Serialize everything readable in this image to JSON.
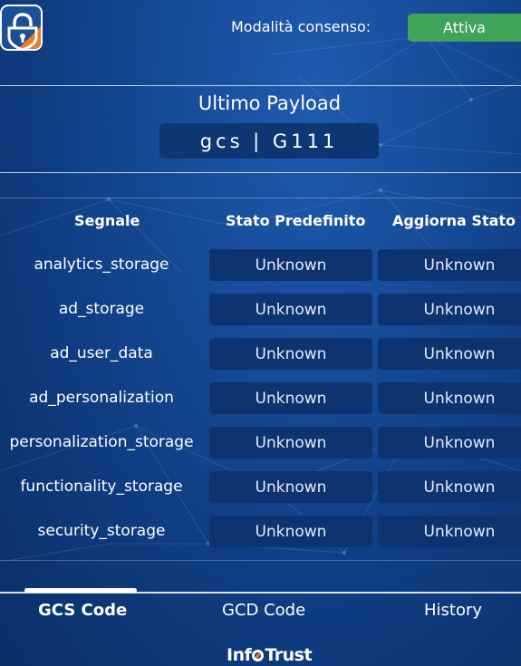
{
  "header": {
    "logo_icon": "lock-shield-icon",
    "consent_label": "Modalità consenso:",
    "consent_status": "Attiva",
    "status_color": "#3fa35a"
  },
  "payload": {
    "title": "Ultimo Payload",
    "value": "gcs | G111"
  },
  "table": {
    "headers": [
      "Segnale",
      "Stato Predefinito",
      "Aggiorna Stato"
    ],
    "rows": [
      {
        "signal": "analytics_storage",
        "default": "Unknown",
        "update": "Unknown"
      },
      {
        "signal": "ad_storage",
        "default": "Unknown",
        "update": "Unknown"
      },
      {
        "signal": "ad_user_data",
        "default": "Unknown",
        "update": "Unknown"
      },
      {
        "signal": "ad_personalization",
        "default": "Unknown",
        "update": "Unknown"
      },
      {
        "signal": "personalization_storage",
        "default": "Unknown",
        "update": "Unknown"
      },
      {
        "signal": "functionality_storage",
        "default": "Unknown",
        "update": "Unknown"
      },
      {
        "signal": "security_storage",
        "default": "Unknown",
        "update": "Unknown"
      }
    ]
  },
  "tabs": [
    {
      "label": "GCS Code",
      "active": true
    },
    {
      "label": "GCD Code",
      "active": false
    },
    {
      "label": "History",
      "active": false
    }
  ],
  "footer": {
    "brand_prefix": "Inf",
    "brand_suffix": "Trust"
  }
}
